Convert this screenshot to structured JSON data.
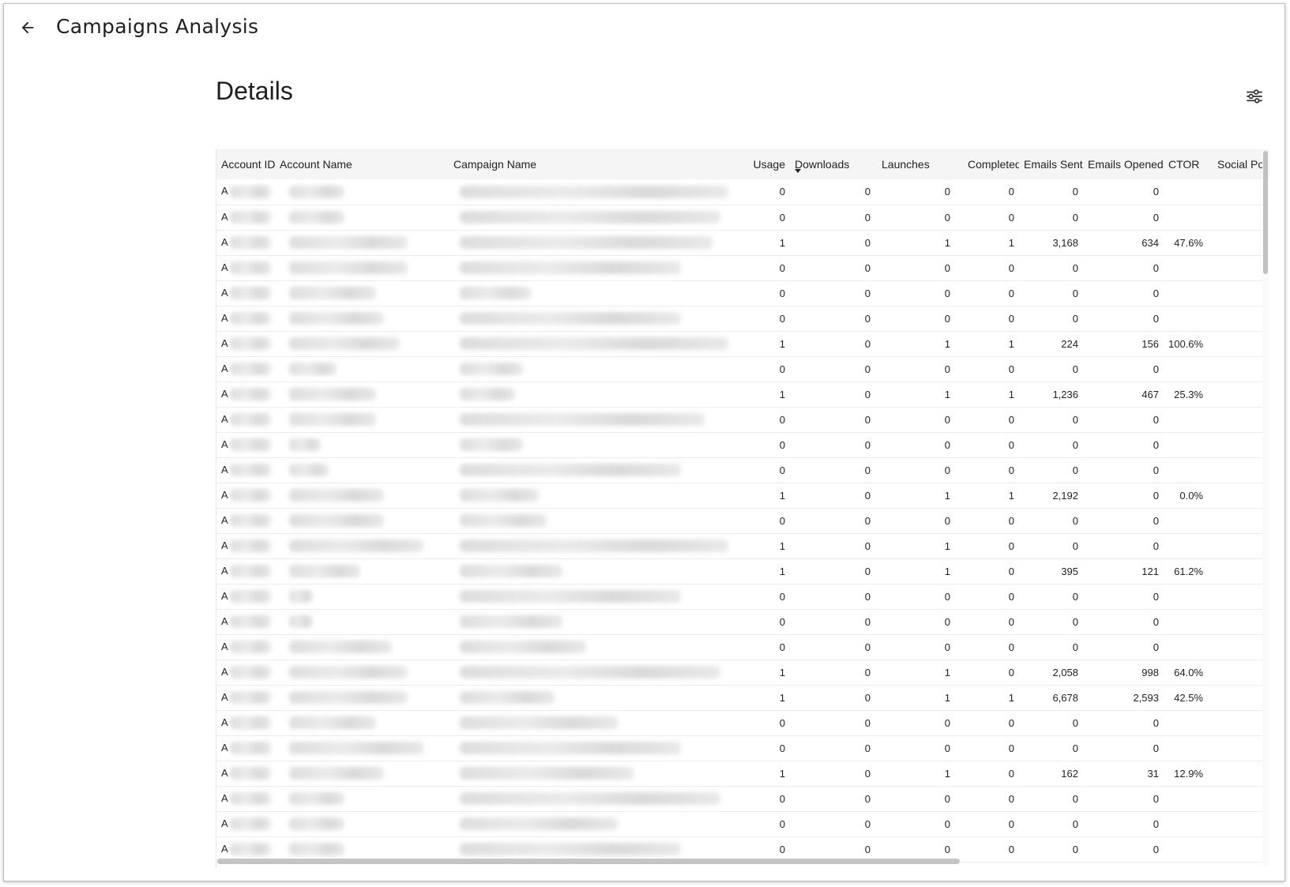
{
  "header": {
    "title": "Campaigns Analysis",
    "back_icon": "arrow-left-icon"
  },
  "section": {
    "title": "Details",
    "filter_icon": "sliders-icon"
  },
  "table": {
    "columns": [
      "Account ID",
      "Account Name",
      "Campaign Name",
      "Usage",
      "Downloads",
      "Launches",
      "Completed",
      "Emails Sent",
      "Emails Opened",
      "CTOR",
      "Social Po"
    ],
    "sorted_column": "Downloads",
    "rows": [
      {
        "id_prefix": "A",
        "usage": "0",
        "downloads": "0",
        "launches": "0",
        "completed": "0",
        "emails_sent": "0",
        "emails_opened": "0",
        "ctor": ""
      },
      {
        "id_prefix": "A",
        "usage": "0",
        "downloads": "0",
        "launches": "0",
        "completed": "0",
        "emails_sent": "0",
        "emails_opened": "0",
        "ctor": ""
      },
      {
        "id_prefix": "A",
        "usage": "1",
        "downloads": "0",
        "launches": "1",
        "completed": "1",
        "emails_sent": "3,168",
        "emails_opened": "634",
        "ctor": "47.6%"
      },
      {
        "id_prefix": "A",
        "usage": "0",
        "downloads": "0",
        "launches": "0",
        "completed": "0",
        "emails_sent": "0",
        "emails_opened": "0",
        "ctor": ""
      },
      {
        "id_prefix": "A",
        "usage": "0",
        "downloads": "0",
        "launches": "0",
        "completed": "0",
        "emails_sent": "0",
        "emails_opened": "0",
        "ctor": ""
      },
      {
        "id_prefix": "A",
        "usage": "0",
        "downloads": "0",
        "launches": "0",
        "completed": "0",
        "emails_sent": "0",
        "emails_opened": "0",
        "ctor": ""
      },
      {
        "id_prefix": "A",
        "usage": "1",
        "downloads": "0",
        "launches": "1",
        "completed": "1",
        "emails_sent": "224",
        "emails_opened": "156",
        "ctor": "100.6%"
      },
      {
        "id_prefix": "A",
        "usage": "0",
        "downloads": "0",
        "launches": "0",
        "completed": "0",
        "emails_sent": "0",
        "emails_opened": "0",
        "ctor": ""
      },
      {
        "id_prefix": "A",
        "usage": "1",
        "downloads": "0",
        "launches": "1",
        "completed": "1",
        "emails_sent": "1,236",
        "emails_opened": "467",
        "ctor": "25.3%"
      },
      {
        "id_prefix": "A",
        "usage": "0",
        "downloads": "0",
        "launches": "0",
        "completed": "0",
        "emails_sent": "0",
        "emails_opened": "0",
        "ctor": ""
      },
      {
        "id_prefix": "A",
        "usage": "0",
        "downloads": "0",
        "launches": "0",
        "completed": "0",
        "emails_sent": "0",
        "emails_opened": "0",
        "ctor": ""
      },
      {
        "id_prefix": "A",
        "usage": "0",
        "downloads": "0",
        "launches": "0",
        "completed": "0",
        "emails_sent": "0",
        "emails_opened": "0",
        "ctor": ""
      },
      {
        "id_prefix": "A",
        "usage": "1",
        "downloads": "0",
        "launches": "1",
        "completed": "1",
        "emails_sent": "2,192",
        "emails_opened": "0",
        "ctor": "0.0%"
      },
      {
        "id_prefix": "A",
        "usage": "0",
        "downloads": "0",
        "launches": "0",
        "completed": "0",
        "emails_sent": "0",
        "emails_opened": "0",
        "ctor": ""
      },
      {
        "id_prefix": "A",
        "usage": "1",
        "downloads": "0",
        "launches": "1",
        "completed": "0",
        "emails_sent": "0",
        "emails_opened": "0",
        "ctor": ""
      },
      {
        "id_prefix": "A",
        "usage": "1",
        "downloads": "0",
        "launches": "1",
        "completed": "0",
        "emails_sent": "395",
        "emails_opened": "121",
        "ctor": "61.2%"
      },
      {
        "id_prefix": "A",
        "usage": "0",
        "downloads": "0",
        "launches": "0",
        "completed": "0",
        "emails_sent": "0",
        "emails_opened": "0",
        "ctor": ""
      },
      {
        "id_prefix": "A",
        "usage": "0",
        "downloads": "0",
        "launches": "0",
        "completed": "0",
        "emails_sent": "0",
        "emails_opened": "0",
        "ctor": ""
      },
      {
        "id_prefix": "A",
        "usage": "0",
        "downloads": "0",
        "launches": "0",
        "completed": "0",
        "emails_sent": "0",
        "emails_opened": "0",
        "ctor": ""
      },
      {
        "id_prefix": "A",
        "usage": "1",
        "downloads": "0",
        "launches": "1",
        "completed": "0",
        "emails_sent": "2,058",
        "emails_opened": "998",
        "ctor": "64.0%"
      },
      {
        "id_prefix": "A",
        "usage": "1",
        "downloads": "0",
        "launches": "1",
        "completed": "1",
        "emails_sent": "6,678",
        "emails_opened": "2,593",
        "ctor": "42.5%"
      },
      {
        "id_prefix": "A",
        "usage": "0",
        "downloads": "0",
        "launches": "0",
        "completed": "0",
        "emails_sent": "0",
        "emails_opened": "0",
        "ctor": ""
      },
      {
        "id_prefix": "A",
        "usage": "0",
        "downloads": "0",
        "launches": "0",
        "completed": "0",
        "emails_sent": "0",
        "emails_opened": "0",
        "ctor": ""
      },
      {
        "id_prefix": "A",
        "usage": "1",
        "downloads": "0",
        "launches": "1",
        "completed": "0",
        "emails_sent": "162",
        "emails_opened": "31",
        "ctor": "12.9%"
      },
      {
        "id_prefix": "A",
        "usage": "0",
        "downloads": "0",
        "launches": "0",
        "completed": "0",
        "emails_sent": "0",
        "emails_opened": "0",
        "ctor": ""
      },
      {
        "id_prefix": "A",
        "usage": "0",
        "downloads": "0",
        "launches": "0",
        "completed": "0",
        "emails_sent": "0",
        "emails_opened": "0",
        "ctor": ""
      },
      {
        "id_prefix": "A",
        "usage": "0",
        "downloads": "0",
        "launches": "0",
        "completed": "0",
        "emails_sent": "0",
        "emails_opened": "0",
        "ctor": ""
      }
    ]
  },
  "colors": {
    "header_bg": "#f5f5f5",
    "row_border": "#ececec",
    "scrollbar": "#c1c1c1",
    "text": "#222222"
  }
}
